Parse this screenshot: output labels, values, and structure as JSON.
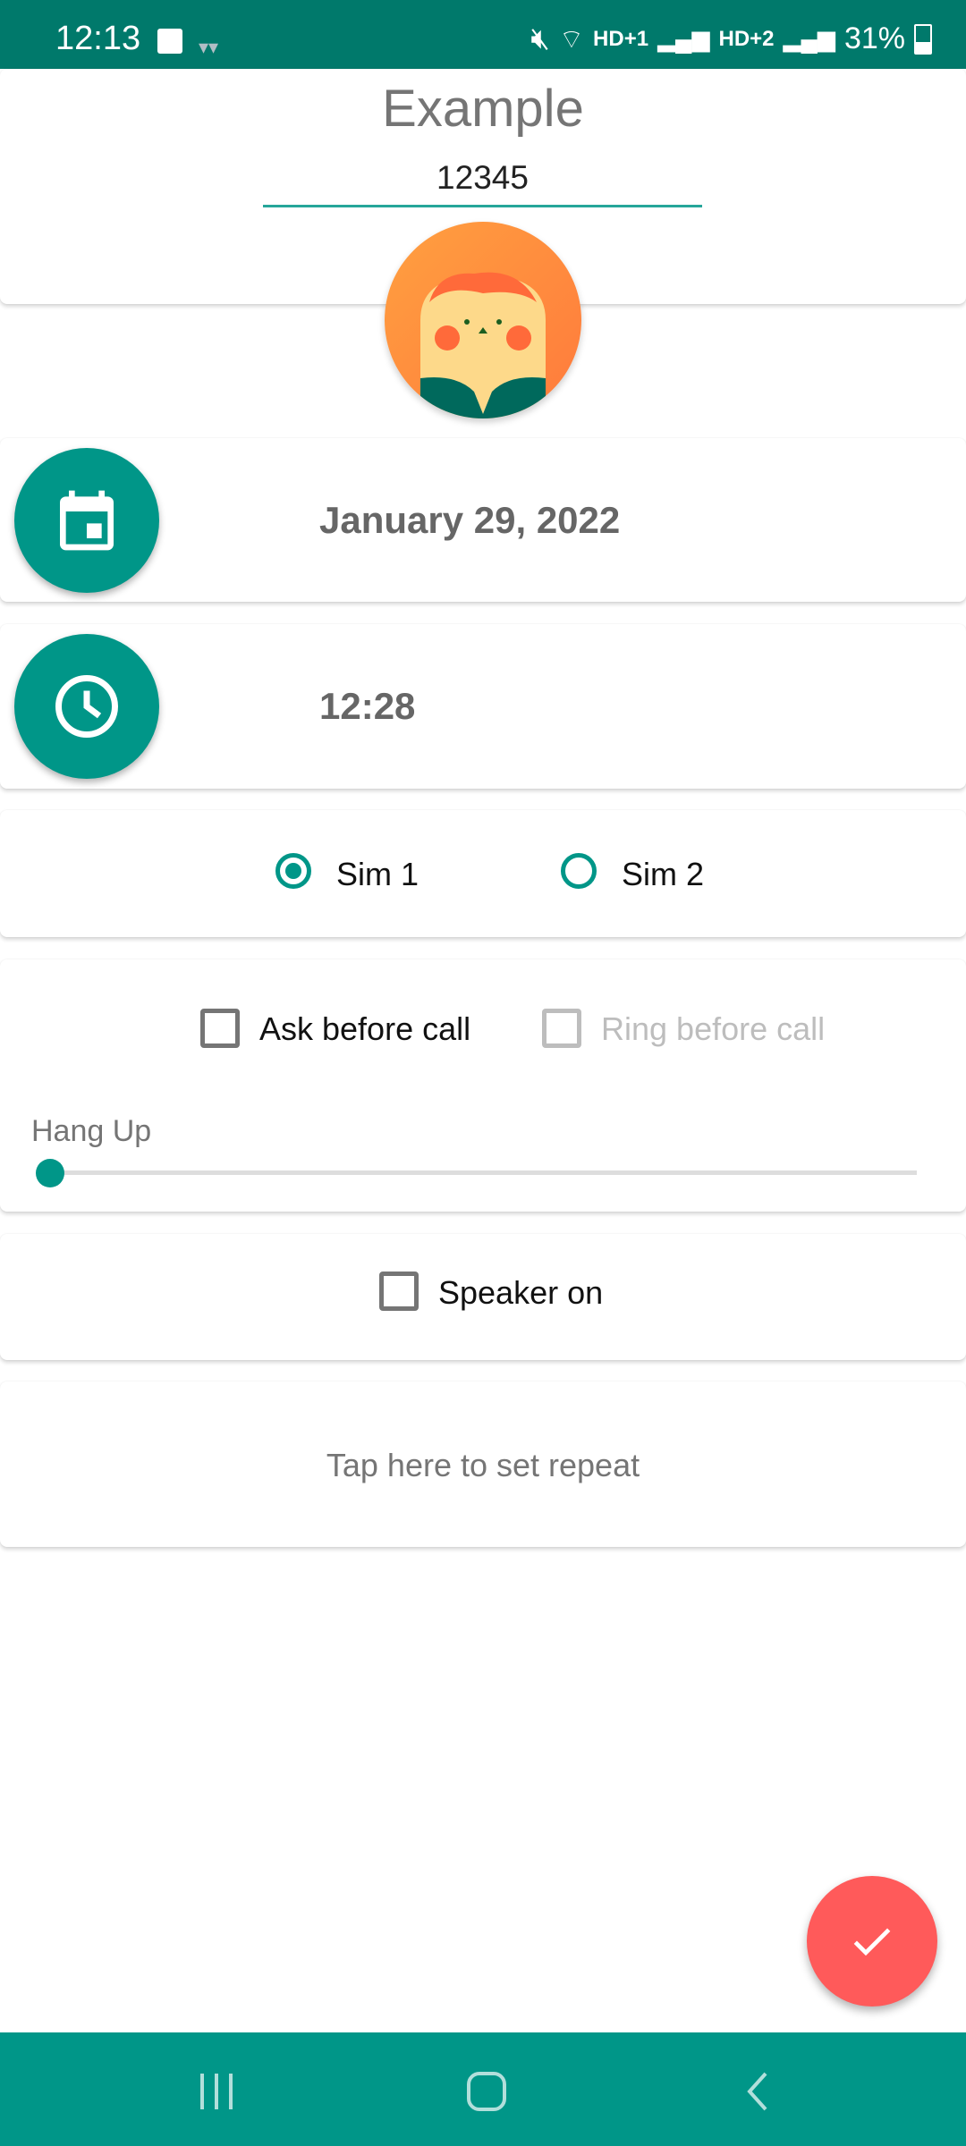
{
  "status_bar": {
    "time": "12:13",
    "battery": "31%",
    "network1": "HD+1",
    "network2": "HD+2",
    "icons": [
      "image-icon",
      "glasses-icon",
      "mute-icon",
      "wifi-icon",
      "signal-icon",
      "battery-icon"
    ]
  },
  "header": {
    "title": "Example",
    "number_value": "12345"
  },
  "date": {
    "value": "January 29, 2022",
    "icon": "calendar-icon"
  },
  "time": {
    "value": "12:28",
    "icon": "clock-icon"
  },
  "sim": {
    "options": [
      {
        "label": "Sim 1",
        "selected": true
      },
      {
        "label": "Sim 2",
        "selected": false
      }
    ]
  },
  "options": {
    "ask_before_call": {
      "label": "Ask before call",
      "checked": false
    },
    "ring_before_call": {
      "label": "Ring before call",
      "checked": false,
      "enabled": false
    }
  },
  "hangup": {
    "label": "Hang Up",
    "value_fraction": 0
  },
  "speaker": {
    "label": "Speaker on",
    "checked": false
  },
  "repeat": {
    "label": "Tap here to set repeat"
  },
  "colors": {
    "primary": "#009688",
    "status_bar": "#00796b",
    "fab": "#ff5a5a"
  },
  "fab": {
    "icon": "check-icon"
  },
  "nav": {
    "icons": [
      "recents-icon",
      "home-icon",
      "back-icon"
    ]
  }
}
